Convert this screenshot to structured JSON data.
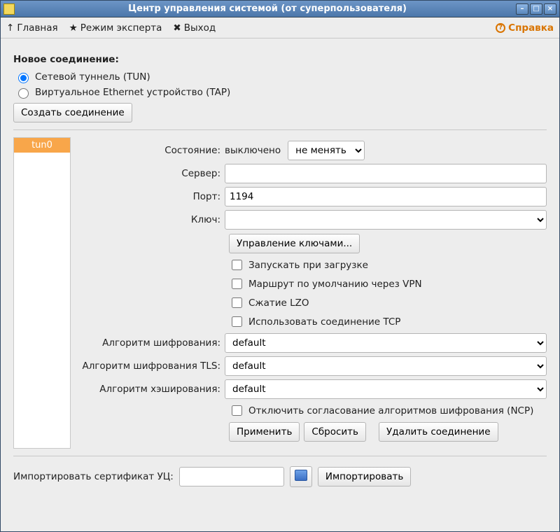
{
  "window": {
    "title": "Центр управления системой (от суперпользователя)"
  },
  "toolbar": {
    "home": "Главная",
    "expert": "Режим эксперта",
    "exit": "Выход",
    "help": "Справка"
  },
  "newconn": {
    "header": "Новое соединение:",
    "tun": "Сетевой туннель (TUN)",
    "tap": "Виртуальное Ethernet устройство (TAP)",
    "create": "Создать соединение"
  },
  "list": {
    "items": [
      "tun0"
    ]
  },
  "labels": {
    "state": "Состояние:",
    "server": "Сервер:",
    "port": "Порт:",
    "key": "Ключ:",
    "cipher": "Алгоритм шифрования:",
    "tlscipher": "Алгоритм шифрования TLS:",
    "digest": "Алгоритм хэширования:"
  },
  "state": {
    "value": "выключено",
    "action": "не менять"
  },
  "fields": {
    "server": "",
    "port": "1194",
    "key": "",
    "cipher": "default",
    "tlscipher": "default",
    "digest": "default"
  },
  "buttons": {
    "manage_keys": "Управление ключами...",
    "apply": "Применить",
    "reset": "Сбросить",
    "delete": "Удалить соединение",
    "import": "Импортировать"
  },
  "checks": {
    "autostart": "Запускать при загрузке",
    "defroute": "Маршрут по умолчанию через VPN",
    "lzo": "Сжатие LZO",
    "tcp": "Использовать соединение TCP",
    "ncp": "Отключить согласование алгоритмов шифрования (NCP)"
  },
  "import": {
    "label": "Импортировать сертификат УЦ:",
    "path": ""
  }
}
